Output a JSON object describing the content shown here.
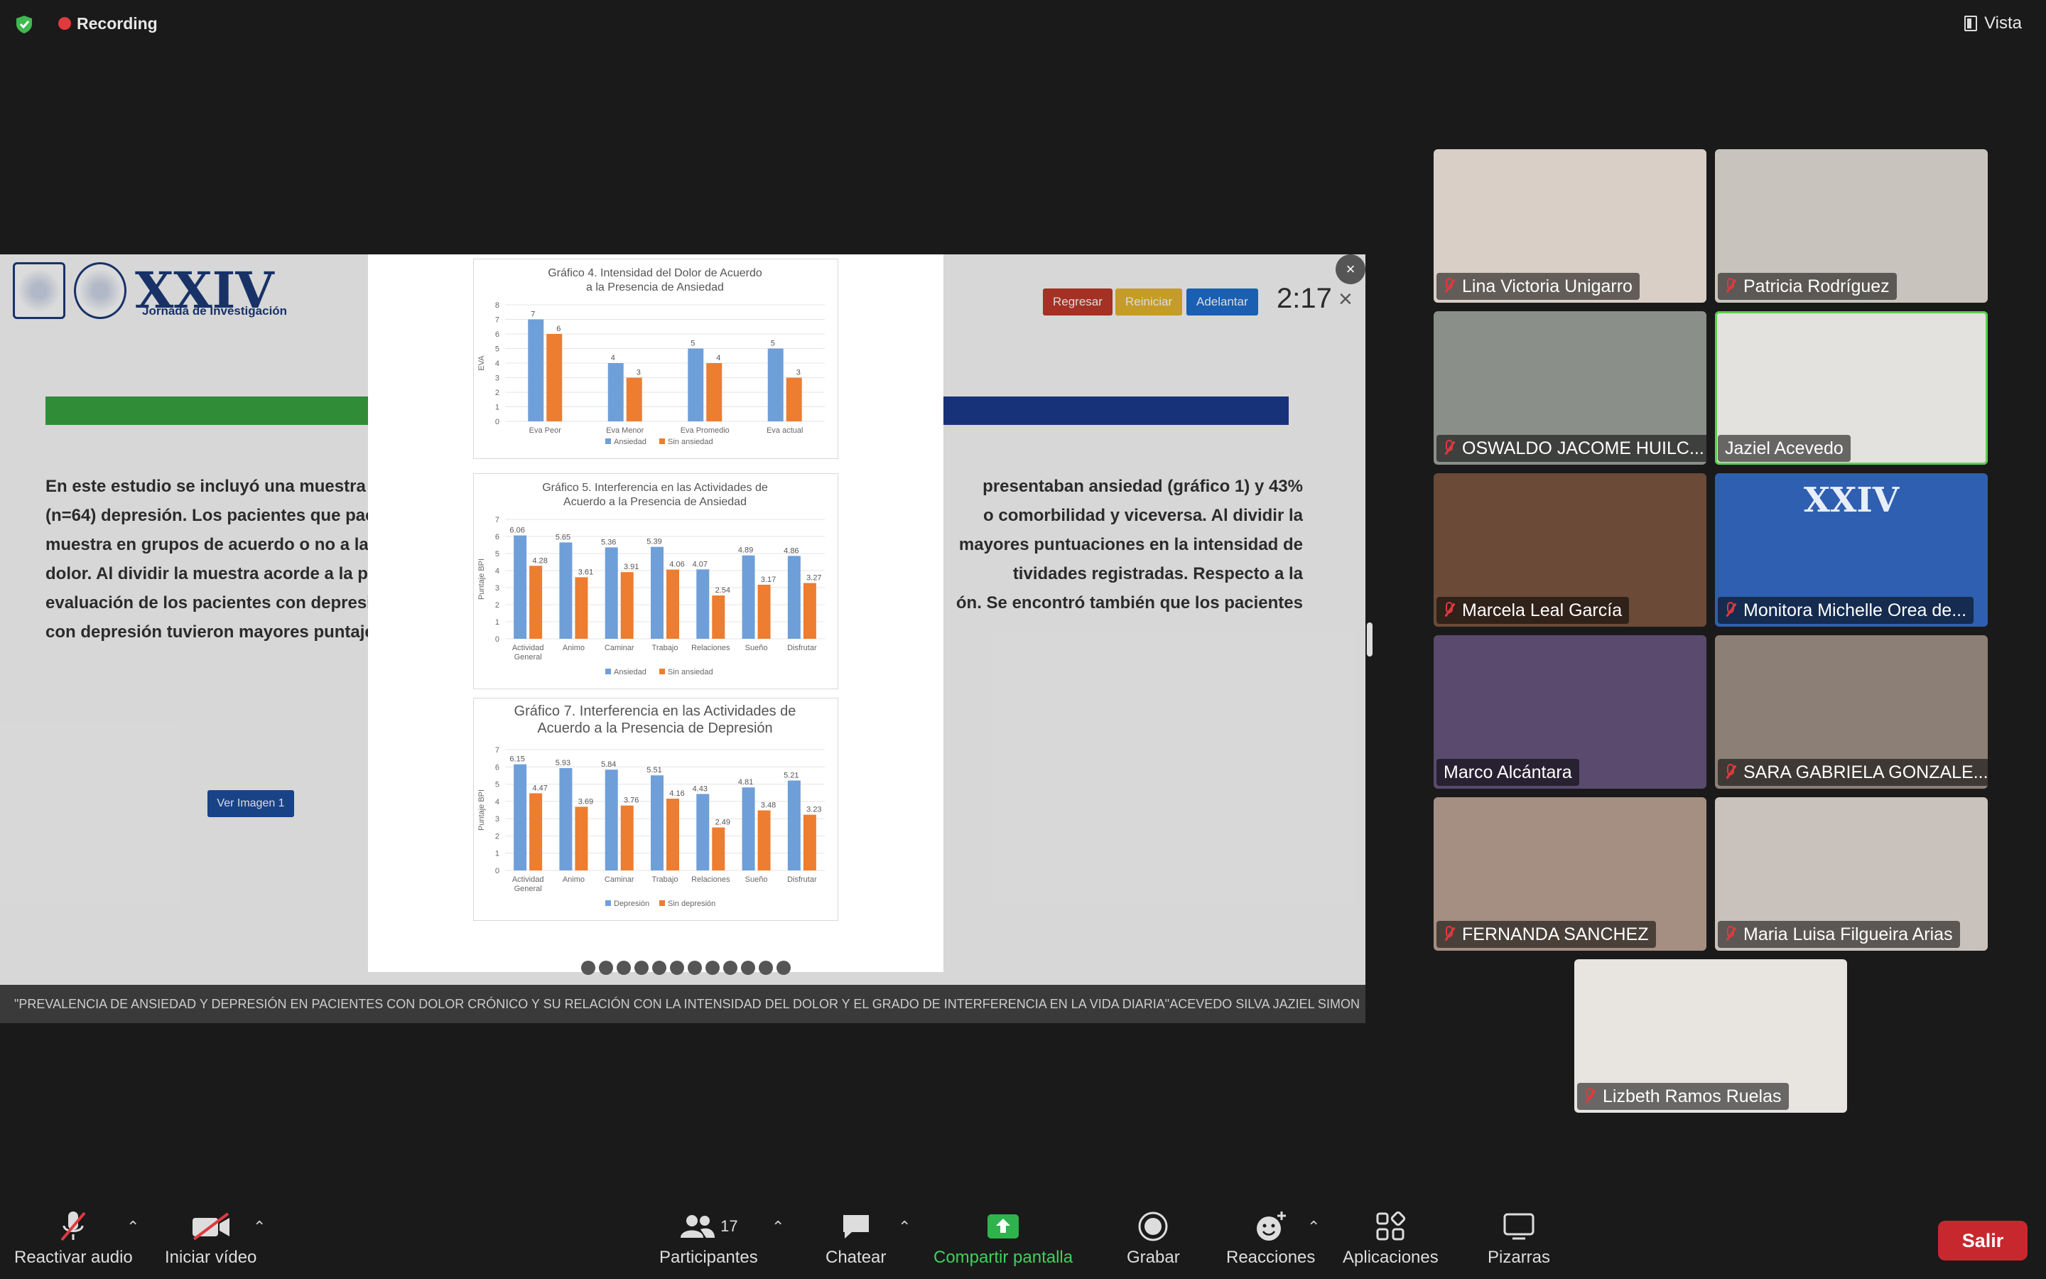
{
  "topbar": {
    "recording_label": "Recording",
    "view_label": "Vista"
  },
  "slide": {
    "conference_title": "XXIV",
    "conference_subtitle": "Jornada de Investigación",
    "buttons": {
      "back": "Regresar",
      "restart": "Reiniciar",
      "forward": "Adelantar"
    },
    "timer": "2:17",
    "paragraph_lines": [
      "En este estudio se incluyó una muestra t",
      "presentaban ansiedad (gráfico 1) y 43%",
      "(n=64) depresión. Los pacientes que pac",
      "o comorbilidad y viceversa. Al dividir la",
      "muestra en grupos de acuerdo o no a la p",
      "mayores puntuaciones en la intensidad de",
      "dolor. Al dividir la muestra acorde a la pre",
      "tividades registradas. Respecto a la",
      "evaluación de los pacientes con depresi",
      "ón. Se encontró también que los pacientes",
      "con depresión tuvieron mayores puntaje"
    ],
    "ver_imagen": "Ver Imagen 1",
    "ticker": "\"PREVALENCIA DE ANSIEDAD Y DEPRESIÓN EN PACIENTES CON DOLOR CRÓNICO Y SU RELACIÓN CON LA INTENSIDAD DEL DOLOR Y EL GRADO DE INTERFERENCIA EN LA VIDA DIARIA\"ACEVEDO SILVA JAZIEL SIMON"
  },
  "chart_data": [
    {
      "type": "bar",
      "title": "Gráfico 4. Intensidad del Dolor de Acuerdo a la Presencia de Ansiedad",
      "ylabel": "EVA",
      "categories": [
        "Eva Peor",
        "Eva Menor",
        "Eva Promedio",
        "Eva actual"
      ],
      "ylim": [
        0,
        8
      ],
      "yticks": [
        0,
        1,
        2,
        3,
        4,
        5,
        6,
        7,
        8
      ],
      "series": [
        {
          "name": "Ansiedad",
          "values": [
            7,
            4,
            5,
            5
          ],
          "color": "#6f9fd8"
        },
        {
          "name": "Sin ansiedad",
          "values": [
            6,
            3,
            4,
            3
          ],
          "color": "#ed7d31"
        }
      ]
    },
    {
      "type": "bar",
      "title": "Gráfico 5. Interferencia en las Actividades de Acuerdo a la Presencia de Ansiedad",
      "ylabel": "Puntaje BPI",
      "categories": [
        "Actividad General",
        "Animo",
        "Caminar",
        "Trabajo",
        "Relaciones",
        "Sueño",
        "Disfrutar"
      ],
      "ylim": [
        0,
        7
      ],
      "yticks": [
        0,
        1,
        2,
        3,
        4,
        5,
        6,
        7
      ],
      "series": [
        {
          "name": "Ansiedad",
          "values": [
            6.06,
            5.65,
            5.36,
            5.39,
            4.07,
            4.89,
            4.86
          ],
          "color": "#6f9fd8"
        },
        {
          "name": "Sin ansiedad",
          "values": [
            4.28,
            3.61,
            3.91,
            4.06,
            2.54,
            3.17,
            3.27
          ],
          "color": "#ed7d31"
        }
      ]
    },
    {
      "type": "bar",
      "title": "Gráfico 7. Interferencia en las Actividades de Acuerdo a la Presencia de Depresión",
      "ylabel": "Puntaje BPI",
      "categories": [
        "Actividad General",
        "Animo",
        "Caminar",
        "Trabajo",
        "Relaciones",
        "Sueño",
        "Disfrutar"
      ],
      "ylim": [
        0,
        7
      ],
      "yticks": [
        0,
        1,
        2,
        3,
        4,
        5,
        6,
        7
      ],
      "series": [
        {
          "name": "Depresión",
          "values": [
            6.15,
            5.93,
            5.84,
            5.51,
            4.43,
            4.81,
            5.21
          ],
          "color": "#6f9fd8"
        },
        {
          "name": "Sin depresión",
          "values": [
            4.47,
            3.69,
            3.76,
            4.16,
            2.49,
            3.48,
            3.23
          ],
          "color": "#ed7d31"
        }
      ]
    }
  ],
  "participants": [
    {
      "name": "Lina Victoria Unigarro",
      "muted": true,
      "bg": "#d9cfc6"
    },
    {
      "name": "Patricia Rodríguez",
      "muted": true,
      "bg": "#c9c3bd"
    },
    {
      "name": "OSWALDO JACOME HUILC...",
      "muted": true,
      "bg": "#8a8f8a"
    },
    {
      "name": "Jaziel Acevedo",
      "muted": false,
      "speaking": true,
      "bg": "#e4e2de"
    },
    {
      "name": "Marcela Leal García",
      "muted": true,
      "bg": "#6b4a38"
    },
    {
      "name": "Monitora Michelle Orea de...",
      "muted": true,
      "bg": "#2f5fb0"
    },
    {
      "name": "Marco Alcántara",
      "muted": false,
      "bg": "#5a4a6e"
    },
    {
      "name": "SARA GABRIELA GONZALE...",
      "muted": true,
      "bg": "#8c7f75"
    },
    {
      "name": "FERNANDA SANCHEZ",
      "muted": true,
      "bg": "#a58f82"
    },
    {
      "name": "Maria Luisa Filgueira Arias",
      "muted": true,
      "bg": "#c9c2bc"
    },
    {
      "name": "Lizbeth Ramos Ruelas",
      "muted": true,
      "bg": "#e8e4e0"
    }
  ],
  "toolbar": {
    "unmute": "Reactivar audio",
    "start_video": "Iniciar vídeo",
    "participants": "Participantes",
    "participants_count": "17",
    "chat": "Chatear",
    "share_screen": "Compartir pantalla",
    "record": "Grabar",
    "reactions": "Reacciones",
    "apps": "Aplicaciones",
    "whiteboards": "Pizarras",
    "leave": "Salir"
  },
  "colors": {
    "share_green": "#2fb34c",
    "leave_red": "#c7282d",
    "speaking_green": "#5ccf4f"
  }
}
